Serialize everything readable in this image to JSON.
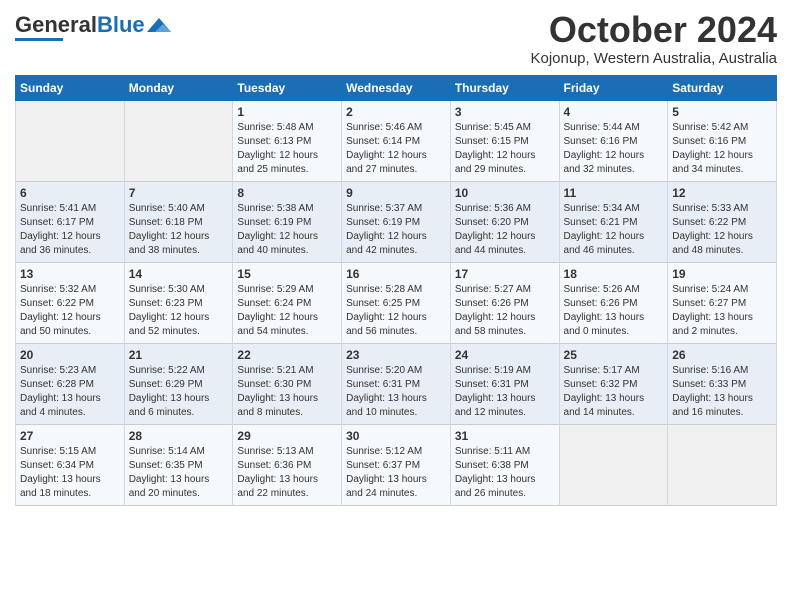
{
  "header": {
    "logo_general": "General",
    "logo_blue": "Blue",
    "month_title": "October 2024",
    "location": "Kojonup, Western Australia, Australia"
  },
  "calendar": {
    "days_of_week": [
      "Sunday",
      "Monday",
      "Tuesday",
      "Wednesday",
      "Thursday",
      "Friday",
      "Saturday"
    ],
    "weeks": [
      [
        {
          "day": "",
          "content": ""
        },
        {
          "day": "",
          "content": ""
        },
        {
          "day": "1",
          "content": "Sunrise: 5:48 AM\nSunset: 6:13 PM\nDaylight: 12 hours\nand 25 minutes."
        },
        {
          "day": "2",
          "content": "Sunrise: 5:46 AM\nSunset: 6:14 PM\nDaylight: 12 hours\nand 27 minutes."
        },
        {
          "day": "3",
          "content": "Sunrise: 5:45 AM\nSunset: 6:15 PM\nDaylight: 12 hours\nand 29 minutes."
        },
        {
          "day": "4",
          "content": "Sunrise: 5:44 AM\nSunset: 6:16 PM\nDaylight: 12 hours\nand 32 minutes."
        },
        {
          "day": "5",
          "content": "Sunrise: 5:42 AM\nSunset: 6:16 PM\nDaylight: 12 hours\nand 34 minutes."
        }
      ],
      [
        {
          "day": "6",
          "content": "Sunrise: 5:41 AM\nSunset: 6:17 PM\nDaylight: 12 hours\nand 36 minutes."
        },
        {
          "day": "7",
          "content": "Sunrise: 5:40 AM\nSunset: 6:18 PM\nDaylight: 12 hours\nand 38 minutes."
        },
        {
          "day": "8",
          "content": "Sunrise: 5:38 AM\nSunset: 6:19 PM\nDaylight: 12 hours\nand 40 minutes."
        },
        {
          "day": "9",
          "content": "Sunrise: 5:37 AM\nSunset: 6:19 PM\nDaylight: 12 hours\nand 42 minutes."
        },
        {
          "day": "10",
          "content": "Sunrise: 5:36 AM\nSunset: 6:20 PM\nDaylight: 12 hours\nand 44 minutes."
        },
        {
          "day": "11",
          "content": "Sunrise: 5:34 AM\nSunset: 6:21 PM\nDaylight: 12 hours\nand 46 minutes."
        },
        {
          "day": "12",
          "content": "Sunrise: 5:33 AM\nSunset: 6:22 PM\nDaylight: 12 hours\nand 48 minutes."
        }
      ],
      [
        {
          "day": "13",
          "content": "Sunrise: 5:32 AM\nSunset: 6:22 PM\nDaylight: 12 hours\nand 50 minutes."
        },
        {
          "day": "14",
          "content": "Sunrise: 5:30 AM\nSunset: 6:23 PM\nDaylight: 12 hours\nand 52 minutes."
        },
        {
          "day": "15",
          "content": "Sunrise: 5:29 AM\nSunset: 6:24 PM\nDaylight: 12 hours\nand 54 minutes."
        },
        {
          "day": "16",
          "content": "Sunrise: 5:28 AM\nSunset: 6:25 PM\nDaylight: 12 hours\nand 56 minutes."
        },
        {
          "day": "17",
          "content": "Sunrise: 5:27 AM\nSunset: 6:26 PM\nDaylight: 12 hours\nand 58 minutes."
        },
        {
          "day": "18",
          "content": "Sunrise: 5:26 AM\nSunset: 6:26 PM\nDaylight: 13 hours\nand 0 minutes."
        },
        {
          "day": "19",
          "content": "Sunrise: 5:24 AM\nSunset: 6:27 PM\nDaylight: 13 hours\nand 2 minutes."
        }
      ],
      [
        {
          "day": "20",
          "content": "Sunrise: 5:23 AM\nSunset: 6:28 PM\nDaylight: 13 hours\nand 4 minutes."
        },
        {
          "day": "21",
          "content": "Sunrise: 5:22 AM\nSunset: 6:29 PM\nDaylight: 13 hours\nand 6 minutes."
        },
        {
          "day": "22",
          "content": "Sunrise: 5:21 AM\nSunset: 6:30 PM\nDaylight: 13 hours\nand 8 minutes."
        },
        {
          "day": "23",
          "content": "Sunrise: 5:20 AM\nSunset: 6:31 PM\nDaylight: 13 hours\nand 10 minutes."
        },
        {
          "day": "24",
          "content": "Sunrise: 5:19 AM\nSunset: 6:31 PM\nDaylight: 13 hours\nand 12 minutes."
        },
        {
          "day": "25",
          "content": "Sunrise: 5:17 AM\nSunset: 6:32 PM\nDaylight: 13 hours\nand 14 minutes."
        },
        {
          "day": "26",
          "content": "Sunrise: 5:16 AM\nSunset: 6:33 PM\nDaylight: 13 hours\nand 16 minutes."
        }
      ],
      [
        {
          "day": "27",
          "content": "Sunrise: 5:15 AM\nSunset: 6:34 PM\nDaylight: 13 hours\nand 18 minutes."
        },
        {
          "day": "28",
          "content": "Sunrise: 5:14 AM\nSunset: 6:35 PM\nDaylight: 13 hours\nand 20 minutes."
        },
        {
          "day": "29",
          "content": "Sunrise: 5:13 AM\nSunset: 6:36 PM\nDaylight: 13 hours\nand 22 minutes."
        },
        {
          "day": "30",
          "content": "Sunrise: 5:12 AM\nSunset: 6:37 PM\nDaylight: 13 hours\nand 24 minutes."
        },
        {
          "day": "31",
          "content": "Sunrise: 5:11 AM\nSunset: 6:38 PM\nDaylight: 13 hours\nand 26 minutes."
        },
        {
          "day": "",
          "content": ""
        },
        {
          "day": "",
          "content": ""
        }
      ]
    ]
  }
}
